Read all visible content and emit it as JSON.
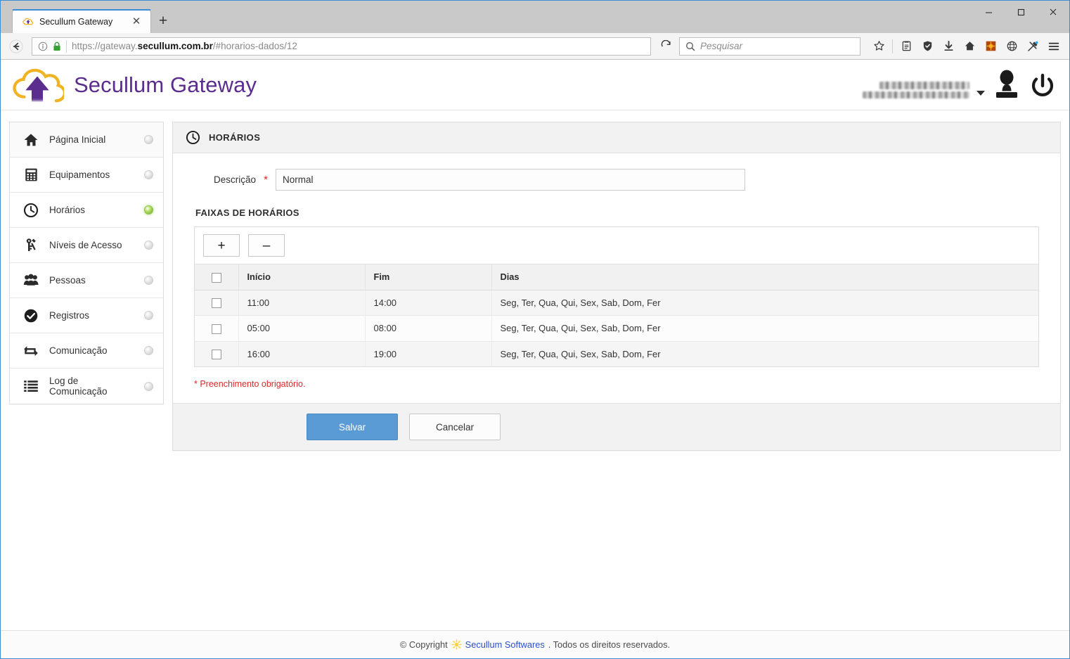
{
  "browser": {
    "tab": {
      "title": "Secullum Gateway",
      "favicon": "cloud-arrow-favicon",
      "close_label": "✕"
    },
    "newtab_label": "+",
    "window_controls": {
      "minimize": "minimize-icon",
      "maximize": "maximize-icon",
      "close": "close-icon"
    },
    "back_label": "back-arrow-icon",
    "url": {
      "scheme": "https://gateway.",
      "domain": "secullum.com.br",
      "path": "/#horarios-dados/12"
    },
    "reload_label": "reload-icon",
    "search": {
      "placeholder": "Pesquisar",
      "icon": "search-icon"
    },
    "toolbar_icons": [
      "star-icon",
      "library-icon",
      "shield-icon",
      "download-icon",
      "home-icon",
      "extension-orange-icon",
      "globe-icon",
      "pocket-sync-icon",
      "hamburger-menu-icon"
    ]
  },
  "app": {
    "brand": "Secullum Gateway",
    "logo": "cloud-upload-logo",
    "user": {
      "name_masked": true,
      "avatar": "user-avatar-icon",
      "caret": "chevron-down-icon",
      "power": "power-icon"
    }
  },
  "sidebar": {
    "items": [
      {
        "label": "Página Inicial",
        "icon": "home-icon",
        "active": false
      },
      {
        "label": "Equipamentos",
        "icon": "calculator-icon",
        "active": false
      },
      {
        "label": "Horários",
        "icon": "clock-icon",
        "active": true
      },
      {
        "label": "Níveis de Acesso",
        "icon": "key-wrench-icon",
        "active": false
      },
      {
        "label": "Pessoas",
        "icon": "people-icon",
        "active": false
      },
      {
        "label": "Registros",
        "icon": "check-circle-icon",
        "active": false
      },
      {
        "label": "Comunicação",
        "icon": "sync-arrows-icon",
        "active": false
      },
      {
        "label": "Log de Comunicação",
        "icon": "list-icon",
        "active": false
      }
    ]
  },
  "panel": {
    "title": "HORÁRIOS",
    "title_icon": "clock-icon",
    "description_field": {
      "label": "Descrição",
      "required_mark": "*",
      "value": "Normal",
      "placeholder": ""
    },
    "section_title": "FAIXAS DE HORÁRIOS",
    "toolbar": {
      "add_label": "+",
      "remove_label": "–"
    },
    "table": {
      "select_all_checkbox": "",
      "columns": [
        "Início",
        "Fim",
        "Dias"
      ],
      "rows": [
        {
          "checked": false,
          "inicio": "11:00",
          "fim": "14:00",
          "dias": "Seg, Ter, Qua, Qui, Sex, Sab, Dom, Fer"
        },
        {
          "checked": false,
          "inicio": "05:00",
          "fim": "08:00",
          "dias": "Seg, Ter, Qua, Qui, Sex, Sab, Dom, Fer"
        },
        {
          "checked": false,
          "inicio": "16:00",
          "fim": "19:00",
          "dias": "Seg, Ter, Qua, Qui, Sex, Sab, Dom, Fer"
        }
      ]
    },
    "required_note": "* Preenchimento obrigatório.",
    "actions": {
      "save": "Salvar",
      "cancel": "Cancelar"
    }
  },
  "footer": {
    "copyright_prefix": "© Copyright",
    "icon": "sun-gear-icon",
    "link": "Secullum Softwares",
    "copyright_suffix": ". Todos os direitos reservados."
  },
  "colors": {
    "brand_purple": "#5b2d8e",
    "accent_blue": "#5b9bd5",
    "required_red": "#d82a2a",
    "active_green": "#8cc846",
    "link_blue": "#2a4fd0"
  }
}
